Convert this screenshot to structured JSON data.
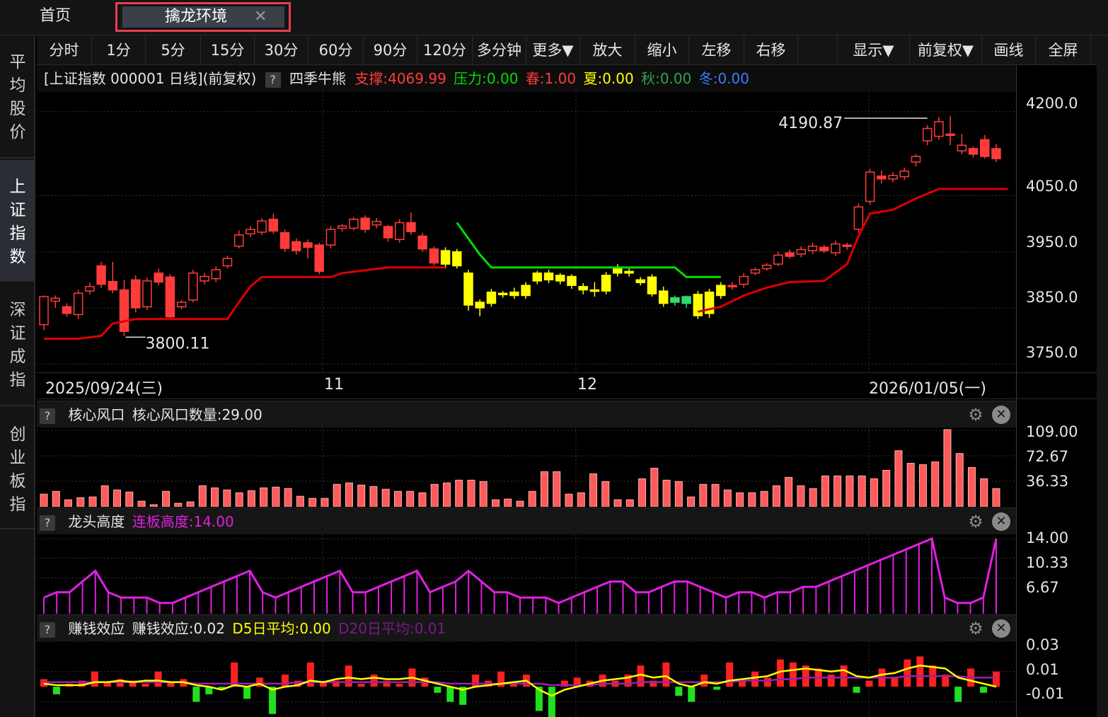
{
  "tabs": {
    "home": "首页",
    "active": "擒龙环境",
    "close": "✕"
  },
  "toolbar": [
    "分时",
    "1分",
    "5分",
    "15分",
    "30分",
    "60分",
    "90分",
    "120分",
    "多分钟",
    "更多▼",
    "放大",
    "缩小",
    "左移",
    "右移",
    "",
    "显示▼",
    "前复权▼",
    "画线",
    "全屏"
  ],
  "sidebar": [
    "平均股价",
    "上证指数",
    "深证成指",
    "创业板指"
  ],
  "main_info": {
    "title": "[上证指数 000001 日线]",
    "adjust": "(前复权)",
    "help": "?",
    "indicator": "四季牛熊",
    "support": "支撑:4069.99",
    "pressure": "压力:0.00",
    "spring": "春:1.00",
    "summer": "夏:0.00",
    "autumn": "秋:0.00",
    "winter": "冬:0.00"
  },
  "colors": {
    "up": "#ff3b3b",
    "down": "#2fdc70",
    "yellow": "#ffff00",
    "green_line": "#00dd00",
    "red_line": "#dd0000",
    "magenta": "#e020e0",
    "pressure": "#00dd00",
    "summer": "#ffff00",
    "autumn": "#2fa04a",
    "winter": "#3a7cff"
  },
  "main_axis": {
    "labels": [
      "4200.0",
      "4050.0",
      "3950.0",
      "3850.0",
      "3750.0"
    ],
    "max_label": "4190.87",
    "min_label": "3800.11"
  },
  "date_axis": [
    "2025/09/24(三)",
    "11",
    "12",
    "2026/01/05(一)"
  ],
  "panel1": {
    "help": "?",
    "name": "核心风口",
    "field": "核心风口数量:29.00",
    "axis": [
      "109.00",
      "72.67",
      "36.33"
    ]
  },
  "panel2": {
    "help": "?",
    "name": "龙头高度",
    "field": "连板高度:14.00",
    "axis": [
      "14.00",
      "10.33",
      "6.67"
    ]
  },
  "panel3": {
    "help": "?",
    "name": "赚钱效应",
    "field": "赚钱效应:0.02",
    "d5": "D5日平均:0.00",
    "d20": "D20日平均:0.01",
    "axis": [
      "0.03",
      "0.01",
      "-0.01"
    ]
  },
  "icons": {
    "gear": "gear-icon",
    "close": "close-icon",
    "help": "help-icon"
  },
  "chart_data": [
    {
      "type": "candlestick",
      "title": "[上证指数 000001 日线]",
      "annotations": [
        "4190.87",
        "3800.11"
      ],
      "ylim": [
        3735,
        4235
      ],
      "candles": [
        [
          3820,
          3870,
          3810,
          3872
        ],
        [
          3862,
          3867,
          3850,
          3872
        ],
        [
          3852,
          3840,
          3834,
          3858
        ],
        [
          3838,
          3876,
          3830,
          3882
        ],
        [
          3880,
          3888,
          3874,
          3895
        ],
        [
          3925,
          3892,
          3885,
          3932
        ],
        [
          3897,
          3882,
          3876,
          3932
        ],
        [
          3882,
          3808,
          3800,
          3900
        ],
        [
          3900,
          3850,
          3842,
          3908
        ],
        [
          3852,
          3898,
          3846,
          3904
        ],
        [
          3912,
          3896,
          3890,
          3920
        ],
        [
          3905,
          3834,
          3830,
          3910
        ],
        [
          3852,
          3860,
          3848,
          3864
        ],
        [
          3864,
          3912,
          3860,
          3918
        ],
        [
          3898,
          3906,
          3892,
          3912
        ],
        [
          3902,
          3918,
          3896,
          3924
        ],
        [
          3925,
          3938,
          3920,
          3943
        ],
        [
          3960,
          3980,
          3956,
          3988
        ],
        [
          3982,
          3990,
          3976,
          3996
        ],
        [
          3985,
          4005,
          3980,
          4010
        ],
        [
          4008,
          3987,
          3982,
          4018
        ],
        [
          3984,
          3956,
          3950,
          3990
        ],
        [
          3968,
          3952,
          3945,
          3974
        ],
        [
          3966,
          3958,
          3938,
          3972
        ],
        [
          3962,
          3915,
          3910,
          3966
        ],
        [
          3962,
          3990,
          3956,
          3996
        ],
        [
          3992,
          3996,
          3986,
          4000
        ],
        [
          3992,
          4008,
          3988,
          4012
        ],
        [
          4010,
          3990,
          3984,
          4015
        ],
        [
          3998,
          4004,
          3992,
          4010
        ],
        [
          3995,
          3975,
          3968,
          3998
        ],
        [
          3972,
          4002,
          3966,
          4008
        ],
        [
          4002,
          3986,
          3980,
          4020
        ],
        [
          3978,
          3955,
          3950,
          3984
        ],
        [
          3955,
          3930,
          3925,
          3960
        ],
        [
          3928,
          3952,
          3920,
          3958
        ],
        [
          3925,
          3950,
          3920,
          3955
        ],
        [
          3912,
          3855,
          3845,
          3918
        ],
        [
          3860,
          3850,
          3835,
          3865
        ],
        [
          3858,
          3878,
          3852,
          3884
        ],
        [
          3874,
          3876,
          3868,
          3880
        ],
        [
          3872,
          3878,
          3866,
          3886
        ],
        [
          3872,
          3890,
          3866,
          3896
        ],
        [
          3898,
          3912,
          3892,
          3916
        ],
        [
          3912,
          3900,
          3894,
          3918
        ],
        [
          3898,
          3908,
          3892,
          3912
        ],
        [
          3906,
          3890,
          3884,
          3910
        ],
        [
          3888,
          3882,
          3874,
          3894
        ],
        [
          3880,
          3882,
          3870,
          3896
        ],
        [
          3880,
          3908,
          3874,
          3914
        ],
        [
          3912,
          3920,
          3906,
          3928
        ],
        [
          3915,
          3912,
          3906,
          3920
        ],
        [
          3900,
          3895,
          3890,
          3905
        ],
        [
          3905,
          3875,
          3870,
          3910
        ],
        [
          3880,
          3858,
          3852,
          3888
        ],
        [
          3860,
          3868,
          3854,
          3872
        ],
        [
          3870,
          3858,
          3850,
          3872
        ],
        [
          3836,
          3874,
          3830,
          3880
        ],
        [
          3840,
          3878,
          3832,
          3884
        ],
        [
          3872,
          3890,
          3866,
          3896
        ],
        [
          3890,
          3888,
          3882,
          3896
        ],
        [
          3892,
          3906,
          3886,
          3912
        ],
        [
          3912,
          3918,
          3908,
          3922
        ],
        [
          3920,
          3926,
          3916,
          3930
        ],
        [
          3928,
          3944,
          3924,
          3950
        ],
        [
          3948,
          3942,
          3938,
          3954
        ],
        [
          3946,
          3954,
          3940,
          3960
        ],
        [
          3952,
          3960,
          3946,
          3966
        ],
        [
          3958,
          3952,
          3948,
          3962
        ],
        [
          3948,
          3964,
          3942,
          3970
        ],
        [
          3962,
          3960,
          3954,
          3966
        ],
        [
          3990,
          4030,
          3984,
          4036
        ],
        [
          4040,
          4092,
          4034,
          4098
        ],
        [
          4085,
          4080,
          4072,
          4095
        ],
        [
          4080,
          4086,
          4074,
          4092
        ],
        [
          4084,
          4094,
          4078,
          4100
        ],
        [
          4110,
          4120,
          4102,
          4124
        ],
        [
          4148,
          4170,
          4140,
          4176
        ],
        [
          4156,
          4182,
          4150,
          4190
        ],
        [
          4160,
          4158,
          4140,
          4192
        ],
        [
          4130,
          4140,
          4124,
          4160
        ],
        [
          4134,
          4124,
          4118,
          4138
        ],
        [
          4150,
          4120,
          4116,
          4158
        ],
        [
          4134,
          4116,
          4110,
          4142
        ]
      ],
      "candle_color": [
        "u",
        "u",
        "u",
        "u",
        "u",
        "u",
        "u",
        "u",
        "u",
        "u",
        "u",
        "u",
        "u",
        "u",
        "u",
        "u",
        "u",
        "u",
        "u",
        "u",
        "u",
        "u",
        "u",
        "u",
        "u",
        "u",
        "u",
        "u",
        "u",
        "u",
        "u",
        "u",
        "u",
        "u",
        "u",
        "y",
        "y",
        "y",
        "y",
        "y",
        "y",
        "y",
        "y",
        "y",
        "y",
        "y",
        "y",
        "y",
        "y",
        "y",
        "y",
        "y",
        "y",
        "y",
        "y",
        "g",
        "g",
        "y",
        "y",
        "y",
        "u",
        "u",
        "u",
        "u",
        "u",
        "u",
        "u",
        "u",
        "u",
        "u",
        "u",
        "u",
        "u",
        "u",
        "u",
        "u",
        "u",
        "u",
        "u",
        "u",
        "u",
        "u",
        "u",
        "u",
        "u"
      ]
    },
    {
      "type": "bar",
      "title": "核心风口",
      "series": [
        {
          "name": "核心风口数量",
          "values": [
            18,
            22,
            10,
            13,
            14,
            30,
            24,
            21,
            8,
            3,
            22,
            5,
            7,
            30,
            27,
            24,
            20,
            23,
            27,
            28,
            26,
            15,
            12,
            12,
            32,
            34,
            31,
            29,
            25,
            22,
            22,
            20,
            32,
            34,
            38,
            38,
            36,
            10,
            11,
            8,
            22,
            50,
            50,
            18,
            20,
            47,
            36,
            10,
            10,
            40,
            55,
            38,
            36,
            14,
            32,
            32,
            24,
            20,
            20,
            22,
            30,
            42,
            30,
            26,
            44,
            44,
            44,
            44,
            40,
            52,
            80,
            62,
            60,
            64,
            110,
            76,
            56,
            40,
            26
          ]
        }
      ],
      "ylim": [
        0,
        109
      ]
    },
    {
      "type": "line",
      "title": "龙头高度",
      "series": [
        {
          "name": "连板高度",
          "values": [
            3,
            4,
            4,
            6,
            8,
            4,
            3,
            3,
            3,
            2,
            2,
            3,
            4,
            5,
            6,
            7,
            8,
            4,
            3,
            4,
            5,
            6,
            7,
            8,
            4,
            4,
            5,
            6,
            7,
            8,
            4,
            5,
            6,
            8,
            6,
            4,
            4,
            3,
            3,
            3,
            2,
            3,
            4,
            5,
            6,
            6,
            4,
            4,
            5,
            6,
            6,
            5,
            4,
            3,
            4,
            4,
            3,
            4,
            4,
            5,
            5,
            6,
            7,
            8,
            9,
            10,
            11,
            12,
            13,
            14,
            3,
            2,
            2,
            3,
            14
          ]
        }
      ],
      "ylim": [
        0,
        14
      ]
    },
    {
      "type": "bar",
      "title": "赚钱效应",
      "series": [
        {
          "name": "赚钱效应",
          "values": [
            0.005,
            -0.005,
            0.002,
            0.004,
            0.01,
            0.003,
            0.005,
            0.004,
            0.002,
            0.01,
            0.003,
            0.005,
            -0.01,
            -0.005,
            -0.002,
            0.016,
            -0.008,
            0.006,
            -0.018,
            0.008,
            0.004,
            0.016,
            0.003,
            0.004,
            0.014,
            0.002,
            0.008,
            0.004,
            0.002,
            0.012,
            0.006,
            -0.004,
            -0.01,
            -0.012,
            0.008,
            0.004,
            0.01,
            0.002,
            0.008,
            -0.016,
            -0.02,
            0.004,
            0.006,
            0.004,
            0.008,
            0.004,
            0.008,
            0.014,
            0.004,
            0.016,
            -0.006,
            -0.01,
            0.008,
            -0.002,
            0.016,
            0.004,
            0.01,
            0.006,
            0.018,
            0.016,
            0.014,
            0.012,
            0.008,
            0.014,
            -0.004,
            0.004,
            0.012,
            0.006,
            0.018,
            0.02,
            0.014,
            0.008,
            -0.01,
            0.012,
            -0.004,
            0.01
          ]
        },
        {
          "name": "D5日平均",
          "values": [
            0.002,
            0.001,
            0.001,
            0.001,
            0.003,
            0.003,
            0.004,
            0.003,
            0.004,
            0.004,
            0.003,
            0.003,
            0.001,
            0.0,
            -0.002,
            0.001,
            0.0,
            0.002,
            -0.002,
            0.0,
            0.001,
            0.004,
            0.003,
            0.005,
            0.006,
            0.005,
            0.006,
            0.005,
            0.005,
            0.006,
            0.004,
            0.002,
            0.0,
            -0.002,
            0.0,
            0.001,
            0.002,
            0.003,
            0.004,
            -0.002,
            -0.006,
            -0.002,
            0.0,
            0.002,
            0.004,
            0.005,
            0.006,
            0.008,
            0.006,
            0.007,
            0.002,
            0.0,
            0.003,
            0.002,
            0.004,
            0.005,
            0.006,
            0.007,
            0.01,
            0.011,
            0.012,
            0.011,
            0.01,
            0.011,
            0.007,
            0.006,
            0.008,
            0.009,
            0.012,
            0.014,
            0.013,
            0.012,
            0.006,
            0.004,
            0.002,
            0.0
          ]
        },
        {
          "name": "D20日平均",
          "values": [
            0.003,
            0.003,
            0.003,
            0.003,
            0.003,
            0.003,
            0.003,
            0.003,
            0.003,
            0.003,
            0.003,
            0.003,
            0.002,
            0.002,
            0.002,
            0.002,
            0.002,
            0.002,
            0.002,
            0.002,
            0.003,
            0.003,
            0.003,
            0.003,
            0.003,
            0.003,
            0.003,
            0.003,
            0.003,
            0.003,
            0.003,
            0.003,
            0.002,
            0.002,
            0.002,
            0.002,
            0.002,
            0.002,
            0.002,
            0.002,
            0.001,
            0.001,
            0.001,
            0.001,
            0.002,
            0.002,
            0.002,
            0.003,
            0.003,
            0.003,
            0.003,
            0.003,
            0.003,
            0.003,
            0.003,
            0.004,
            0.004,
            0.004,
            0.005,
            0.005,
            0.006,
            0.006,
            0.006,
            0.006,
            0.006,
            0.006,
            0.006,
            0.006,
            0.007,
            0.007,
            0.007,
            0.007,
            0.007,
            0.006,
            0.006,
            0.006
          ]
        }
      ],
      "ylim": [
        -0.02,
        0.03
      ]
    }
  ]
}
